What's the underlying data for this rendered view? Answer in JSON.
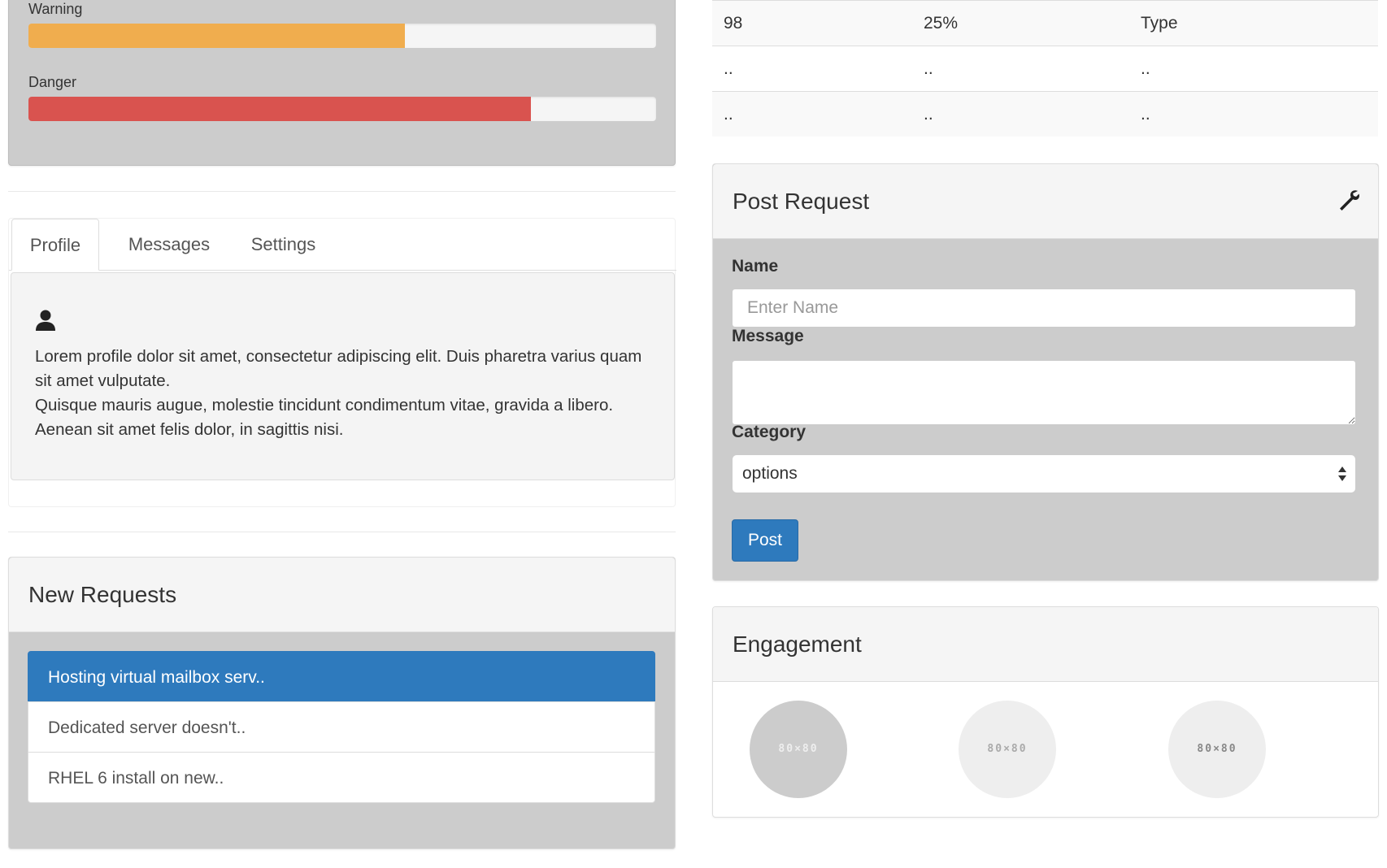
{
  "progress": {
    "warning": {
      "label": "Warning",
      "value_percent": 60,
      "color": "#f0ad4e"
    },
    "danger": {
      "label": "Danger",
      "value_percent": 80,
      "color": "#d9534f"
    }
  },
  "tabs": {
    "items": [
      "Profile",
      "Messages",
      "Settings"
    ],
    "active": "Profile",
    "profile": {
      "icon": "user-icon",
      "line1": "Lorem profile dolor sit amet, consectetur adipiscing elit. Duis pharetra varius quam sit amet vulputate.",
      "line2": "Quisque mauris augue, molestie tincidunt condimentum vitae, gravida a libero. Aenean sit amet felis dolor, in sagittis nisi."
    }
  },
  "new_requests": {
    "title": "New Requests",
    "items": [
      "Hosting virtual mailbox serv..",
      "Dedicated server doesn't..",
      "RHEL 6 install on new.."
    ],
    "active_index": 0,
    "accent": "#2e7abd"
  },
  "table": {
    "rows": [
      [
        "98",
        "25%",
        "Type"
      ],
      [
        "..",
        "..",
        ".."
      ],
      [
        "..",
        "..",
        ".."
      ]
    ]
  },
  "post_request": {
    "title": "Post Request",
    "icon": "wrench-icon",
    "name_label": "Name",
    "name_placeholder": "Enter Name",
    "message_label": "Message",
    "category_label": "Category",
    "category_value": "options",
    "submit_label": "Post"
  },
  "engagement": {
    "title": "Engagement",
    "avatars": [
      {
        "label": "80×80"
      },
      {
        "label": "80×80"
      },
      {
        "label": "80×80"
      }
    ]
  }
}
